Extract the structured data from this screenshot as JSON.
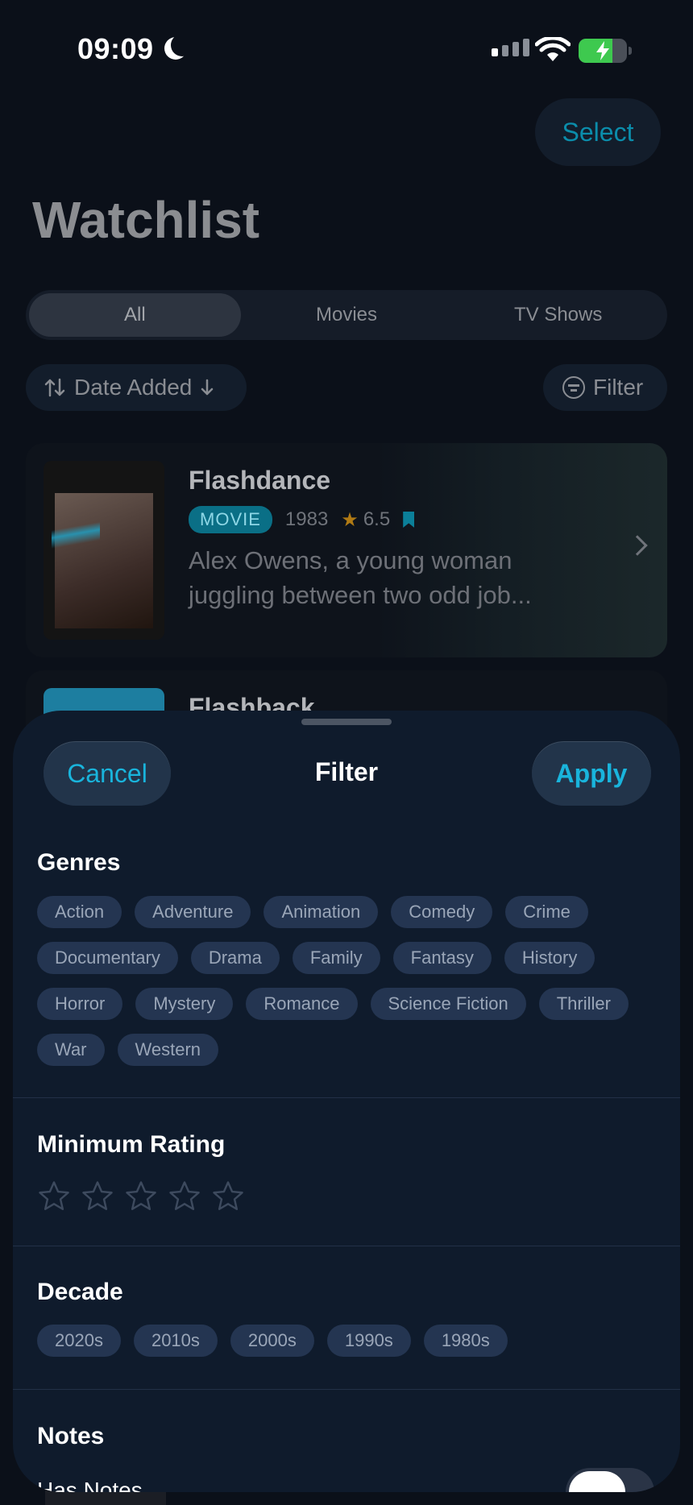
{
  "status_bar": {
    "time": "09:09"
  },
  "header": {
    "select_label": "Select",
    "title": "Watchlist"
  },
  "segments": [
    {
      "label": "All",
      "active": true
    },
    {
      "label": "Movies",
      "active": false
    },
    {
      "label": "TV Shows",
      "active": false
    }
  ],
  "controls": {
    "sort_label": "Date Added",
    "filter_label": "Filter"
  },
  "cards": [
    {
      "title": "Flashdance",
      "type": "MOVIE",
      "year": "1983",
      "rating": "6.5",
      "description": "Alex Owens, a young woman juggling between two odd job..."
    },
    {
      "title": "Flashback"
    }
  ],
  "sheet": {
    "title": "Filter",
    "cancel_label": "Cancel",
    "apply_label": "Apply",
    "genres_title": "Genres",
    "genres": [
      "Action",
      "Adventure",
      "Animation",
      "Comedy",
      "Crime",
      "Documentary",
      "Drama",
      "Family",
      "Fantasy",
      "History",
      "Horror",
      "Mystery",
      "Romance",
      "Science Fiction",
      "Thriller",
      "War",
      "Western"
    ],
    "rating_title": "Minimum Rating",
    "rating_value": 0,
    "rating_max": 5,
    "decade_title": "Decade",
    "decades": [
      "2020s",
      "2010s",
      "2000s",
      "1990s",
      "1980s"
    ],
    "notes_title": "Notes",
    "notes_toggle_label": "Has Notes"
  },
  "colors": {
    "accent": "#19b4dc",
    "sheet_bg": "#0f1b2c",
    "chip_bg": "#243551",
    "battery": "#3ec94f"
  }
}
